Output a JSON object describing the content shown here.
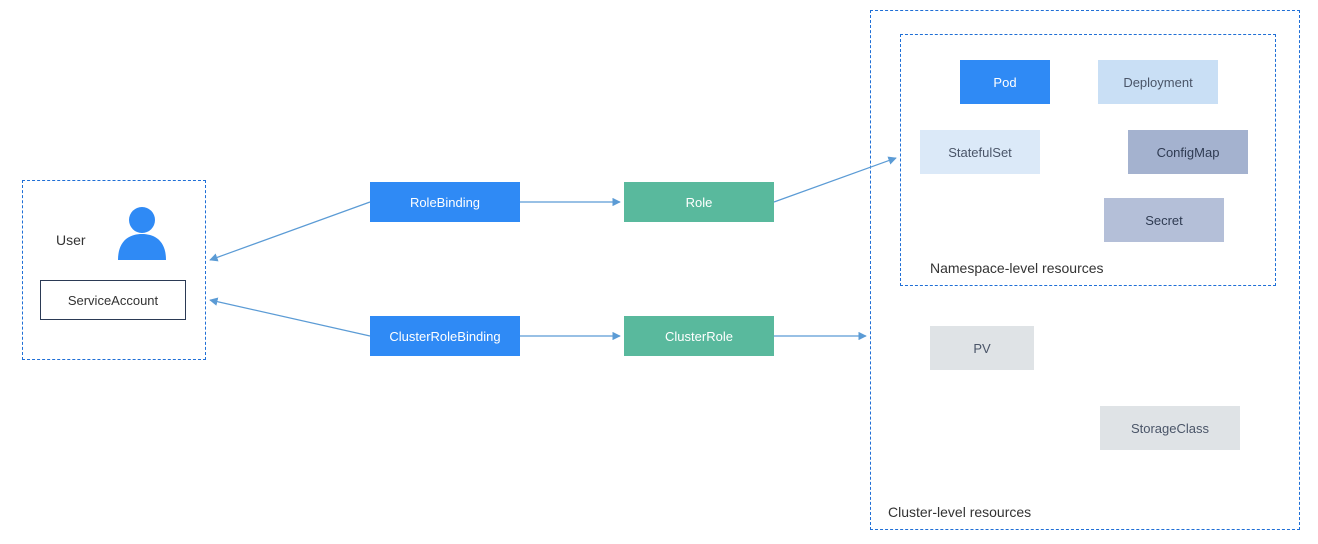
{
  "subjects": {
    "user_label": "User",
    "service_account": "ServiceAccount"
  },
  "bindings": {
    "role_binding": "RoleBinding",
    "cluster_role_binding": "ClusterRoleBinding"
  },
  "roles": {
    "role": "Role",
    "cluster_role": "ClusterRole"
  },
  "namespace_box": {
    "caption": "Namespace-level resources",
    "pod": "Pod",
    "deployment": "Deployment",
    "statefulset": "StatefulSet",
    "configmap": "ConfigMap",
    "secret": "Secret"
  },
  "cluster_box": {
    "caption": "Cluster-level resources",
    "pv": "PV",
    "storageclass": "StorageClass"
  },
  "colors": {
    "dash": "#1f6fd6",
    "blue_fill": "#2f8af5",
    "green_fill": "#59b99d",
    "lightblue1": "#c9dff5",
    "lightblue2": "#dbe9f8",
    "slate": "#a4b2cf",
    "slate2": "#b4bfd8",
    "grey": "#dfe3e6",
    "arrow": "#5b9bd5"
  }
}
